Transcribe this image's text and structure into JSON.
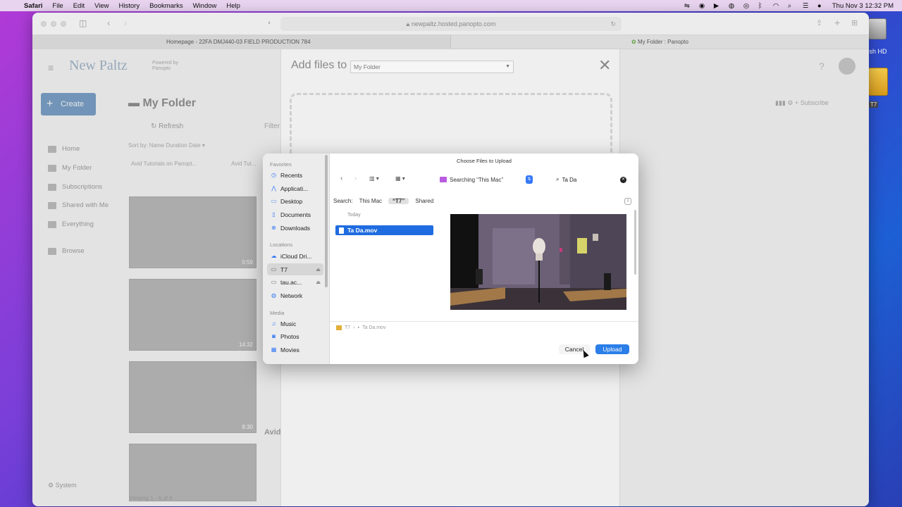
{
  "menubar": {
    "app": "Safari",
    "items": [
      "File",
      "Edit",
      "View",
      "History",
      "Bookmarks",
      "Window",
      "Help"
    ],
    "datetime": "Thu Nov 3  12:32 PM"
  },
  "desktop": {
    "disk_label": "tosh HD",
    "t7_label": "T7"
  },
  "browser": {
    "url": "newpaltz.hosted.panopto.com",
    "tab1_title": "Homepage - 22FA DMJ440-03 FIELD PRODUCTION 784",
    "tab2_title": "My Folder : Panopto"
  },
  "panopto": {
    "logo": "New Paltz",
    "powered_by": "Powered by Panopto",
    "create_label": "Create",
    "sidebar": [
      "Home",
      "My Folder",
      "Subscriptions",
      "Shared with Me",
      "Everything",
      "Browse"
    ],
    "system_label": "System",
    "folder_title": "My Folder",
    "refresh_label": "Refresh",
    "filter_label": "Filter",
    "sort_by": "Sort by:   Name   Duration   Date ▾",
    "crumb1": "Avid Tutorials on Panopt...",
    "crumb2": "Avid Tut...",
    "durations": [
      "0:59",
      "14:32",
      "8:30",
      ""
    ],
    "avid_title": "Avid",
    "viewing": "Viewing 1 - 6 of 6",
    "subscribe": "Subscribe"
  },
  "add_panel": {
    "title": "Add files to",
    "folder_select": "My Folder"
  },
  "dialog": {
    "title": "Choose Files to Upload",
    "favorites_header": "Favorites",
    "favorites": [
      "Recents",
      "Applicati...",
      "Desktop",
      "Documents",
      "Downloads"
    ],
    "locations_header": "Locations",
    "locations": [
      "iCloud Dri...",
      "T7",
      "tau.ac...",
      "Network"
    ],
    "media_header": "Media",
    "media": [
      "Music",
      "Photos",
      "Movies"
    ],
    "location_popup": "Searching “This Mac”",
    "search_value": "Ta Da",
    "scope_label": "Search:",
    "scope_options": [
      "This Mac",
      "“T7”",
      "Shared"
    ],
    "group_header": "Today",
    "selected_file": "Ta Da.mov",
    "path": [
      "T7",
      "Ta Da.mov"
    ],
    "cancel_label": "Cancel",
    "upload_label": "Upload"
  }
}
